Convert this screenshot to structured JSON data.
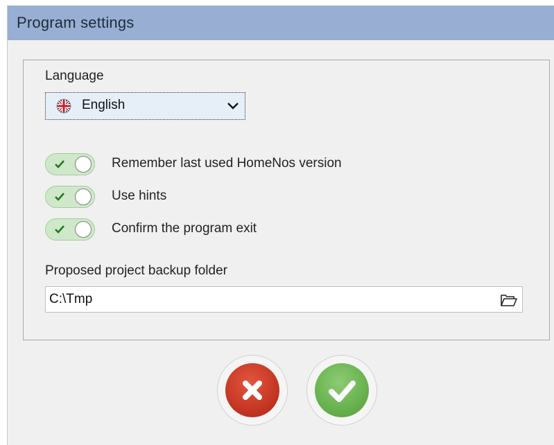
{
  "window": {
    "title": "Program settings"
  },
  "language": {
    "label": "Language",
    "selected": "English",
    "icon": "uk-flag-icon"
  },
  "options": [
    {
      "label": "Remember last used HomeNos version",
      "enabled": true
    },
    {
      "label": "Use hints",
      "enabled": true
    },
    {
      "label": "Confirm the program exit",
      "enabled": true
    }
  ],
  "backup": {
    "label": "Proposed project backup folder",
    "value": "C:\\Tmp",
    "icon": "folder-open-icon"
  },
  "buttons": {
    "cancel_icon": "x-icon",
    "ok_icon": "checkmark-icon"
  },
  "colors": {
    "titlebar": "#98aed2",
    "toggle_on": "#cfe8c9",
    "cancel": "#c0321f",
    "ok": "#62ad48"
  }
}
